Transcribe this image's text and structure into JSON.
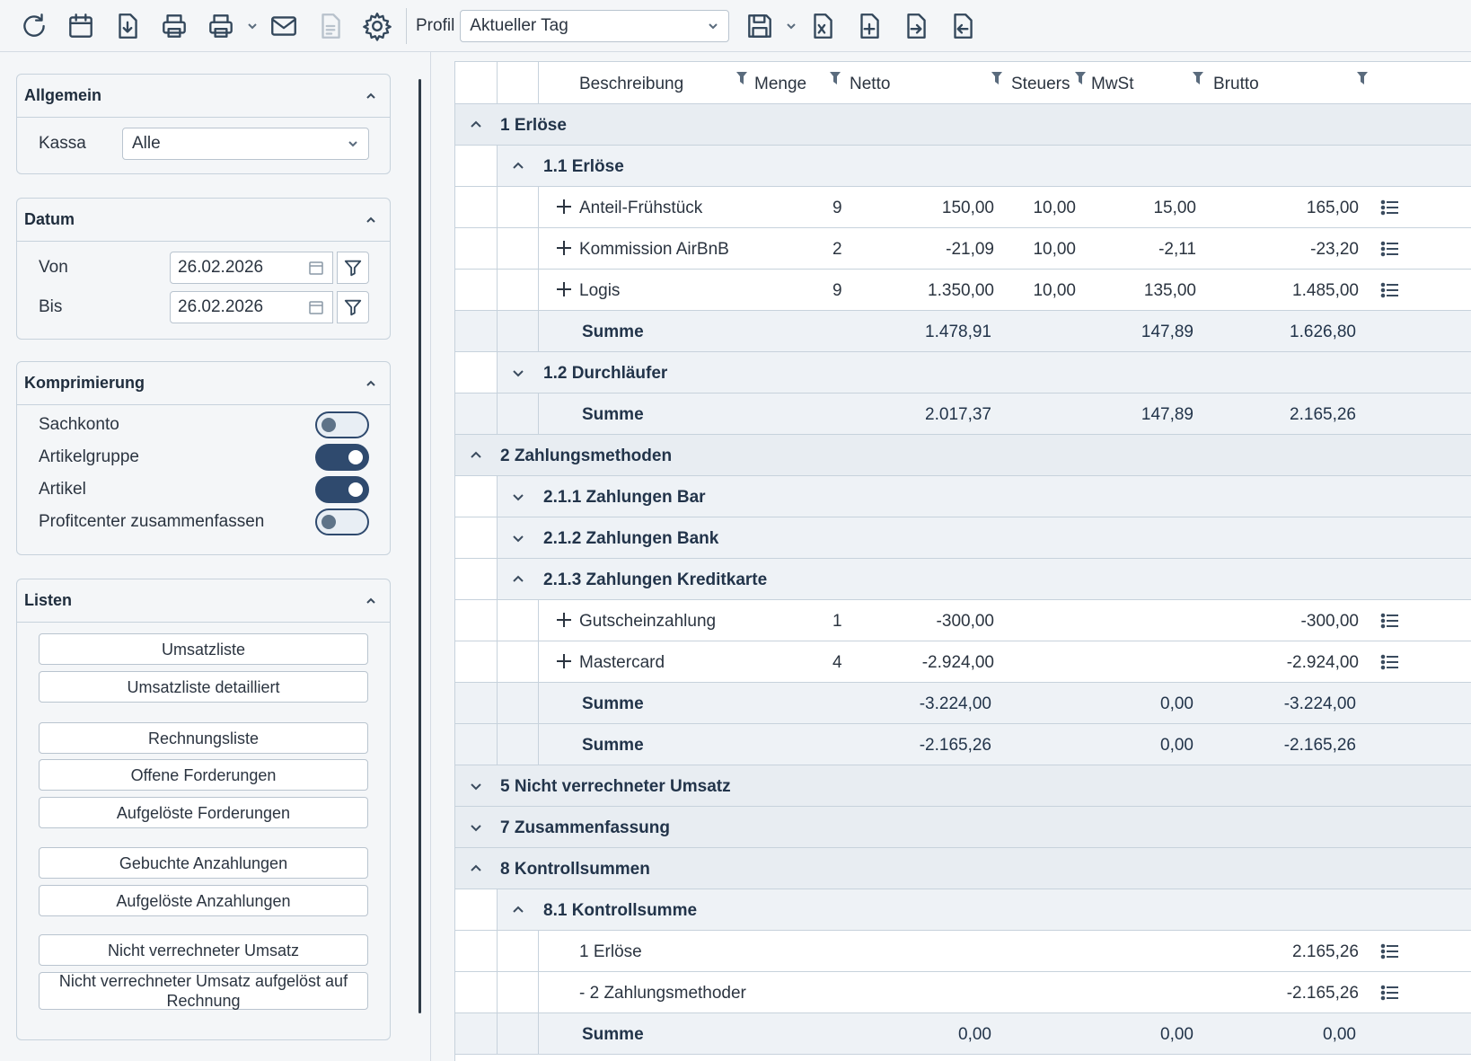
{
  "toolbar": {
    "buttons": [
      "refresh-icon",
      "calendar-icon",
      "download-icon",
      "print-icon",
      "print-options-icon",
      "mail-icon",
      "document-disabled-icon",
      "gear-icon"
    ],
    "profile_label": "Profil",
    "profile_value": "Aktueller Tag",
    "export_buttons": [
      "excel-export-icon",
      "file-add-icon",
      "file-import-icon",
      "file-export-icon"
    ]
  },
  "allgemein": {
    "title": "Allgemein",
    "kassa_label": "Kassa",
    "kassa_value": "Alle"
  },
  "datum": {
    "title": "Datum",
    "von_label": "Von",
    "von_value": "26.02.2026",
    "bis_label": "Bis",
    "bis_value": "26.02.2026"
  },
  "komprimierung": {
    "title": "Komprimierung",
    "items": [
      {
        "label": "Sachkonto",
        "on": false
      },
      {
        "label": "Artikelgruppe",
        "on": true
      },
      {
        "label": "Artikel",
        "on": true
      },
      {
        "label": "Profitcenter zusammenfassen",
        "on": false
      }
    ]
  },
  "listen": {
    "title": "Listen",
    "buttons": [
      "Umsatzliste",
      "Umsatzliste detailliert",
      "Rechnungsliste",
      "Offene Forderungen",
      "Aufgelöste Forderungen",
      "Gebuchte Anzahlungen",
      "Aufgelöste Anzahlungen",
      "Nicht verrechneter Umsatz",
      "Nicht verrechneter Umsatz aufgelöst auf Rechnung"
    ]
  },
  "grid": {
    "columns": {
      "beschreibung": "Beschreibung",
      "menge": "Menge",
      "netto": "Netto",
      "steuers": "Steuers",
      "mwst": "MwSt",
      "brutto": "Brutto"
    },
    "rows": [
      {
        "type": "l1",
        "expanded": true,
        "label": "1 Erlöse"
      },
      {
        "type": "l2",
        "expanded": true,
        "label": "1.1 Erlöse"
      },
      {
        "type": "item",
        "plus": true,
        "label": "Anteil-Frühstück",
        "menge": "9",
        "netto": "150,00",
        "steuer": "10,00",
        "mwst": "15,00",
        "brutto": "165,00",
        "icon": true
      },
      {
        "type": "item",
        "plus": true,
        "label": "Kommission AirBnB",
        "menge": "2",
        "netto": "-21,09",
        "steuer": "10,00",
        "mwst": "-2,11",
        "brutto": "-23,20",
        "icon": true
      },
      {
        "type": "item",
        "plus": true,
        "label": "Logis",
        "menge": "9",
        "netto": "1.350,00",
        "steuer": "10,00",
        "mwst": "135,00",
        "brutto": "1.485,00",
        "icon": true
      },
      {
        "type": "sum",
        "label": "Summe",
        "netto": "1.478,91",
        "mwst": "147,89",
        "brutto": "1.626,80"
      },
      {
        "type": "l2",
        "expanded": false,
        "label": "1.2 Durchläufer"
      },
      {
        "type": "sum",
        "label": "Summe",
        "netto": "2.017,37",
        "mwst": "147,89",
        "brutto": "2.165,26"
      },
      {
        "type": "l1",
        "expanded": true,
        "label": "2 Zahlungsmethoden"
      },
      {
        "type": "l2",
        "expanded": false,
        "label": "2.1.1 Zahlungen Bar"
      },
      {
        "type": "l2",
        "expanded": false,
        "label": "2.1.2 Zahlungen Bank"
      },
      {
        "type": "l2",
        "expanded": true,
        "label": "2.1.3 Zahlungen Kreditkarte"
      },
      {
        "type": "item",
        "plus": true,
        "label": "Gutscheinzahlung",
        "menge": "1",
        "netto": "-300,00",
        "steuer": "",
        "mwst": "",
        "brutto": "-300,00",
        "icon": true
      },
      {
        "type": "item",
        "plus": true,
        "label": "Mastercard",
        "menge": "4",
        "netto": "-2.924,00",
        "steuer": "",
        "mwst": "",
        "brutto": "-2.924,00",
        "icon": true
      },
      {
        "type": "sum",
        "label": "Summe",
        "netto": "-3.224,00",
        "mwst": "0,00",
        "brutto": "-3.224,00"
      },
      {
        "type": "sum",
        "label": "Summe",
        "netto": "-2.165,26",
        "mwst": "0,00",
        "brutto": "-2.165,26"
      },
      {
        "type": "l1",
        "expanded": false,
        "label": "5 Nicht verrechneter Umsatz"
      },
      {
        "type": "l1",
        "expanded": false,
        "label": "7 Zusammenfassung"
      },
      {
        "type": "l1",
        "expanded": true,
        "label": "8 Kontrollsummen"
      },
      {
        "type": "l2",
        "expanded": true,
        "label": "8.1 Kontrollsumme"
      },
      {
        "type": "item",
        "plus": false,
        "label": "1 Erlöse",
        "menge": "",
        "netto": "",
        "steuer": "",
        "mwst": "",
        "brutto": "2.165,26",
        "icon": true
      },
      {
        "type": "item",
        "plus": false,
        "label": "- 2 Zahlungsmethoder",
        "menge": "",
        "netto": "",
        "steuer": "",
        "mwst": "",
        "brutto": "-2.165,26",
        "icon": true
      },
      {
        "type": "sum",
        "label": "Summe",
        "netto": "0,00",
        "mwst": "0,00",
        "brutto": "0,00"
      }
    ]
  }
}
